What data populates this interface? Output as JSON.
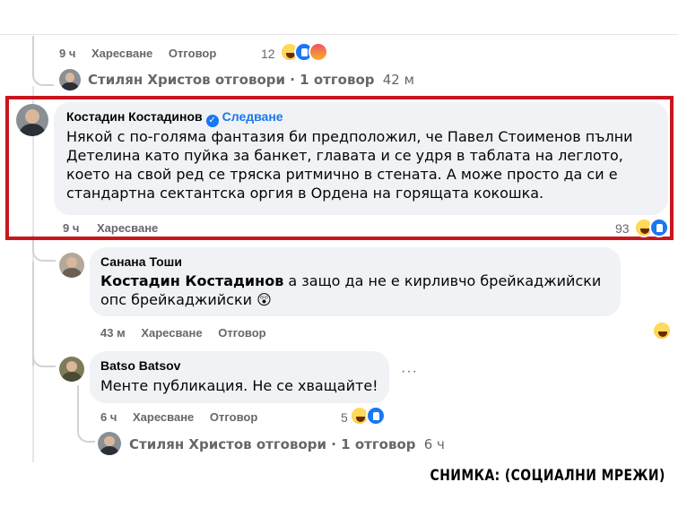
{
  "top_comment": {
    "time": "9 ч",
    "like_label": "Харесване",
    "reply_label": "Отговор",
    "reaction_count": "12"
  },
  "replies_row_1": {
    "text": "Стилян Христов отговори · 1 отговор",
    "time": "42 м"
  },
  "main_comment": {
    "author": "Костадин Костадинов",
    "verified_symbol": "✓",
    "follow_label": "Следване",
    "body": "Някой с по-голяма фантазия би предположил, че Павел Стоименов пълни Детелина като пуйка за банкет, главата и се удря в таблата на леглото, което на свой ред се тряска ритмично в стената. А може просто да си е стандартна сектантска оргия в Ордена на горящата кокошка.",
    "time": "9 ч",
    "like_label": "Харесване",
    "reaction_count": "93"
  },
  "reply_1": {
    "author": "Санана Тоши",
    "mention": "Костадин Костадинов",
    "body": "а защо да не е кирливчо брейкаджийски опс брейкаджийски",
    "emoji": "😲",
    "time": "43 м",
    "like_label": "Харесване",
    "reply_label": "Отговор"
  },
  "reply_2": {
    "author": "Batso Batsov",
    "body": "Менте публикация. Не се хващайте!",
    "time": "6 ч",
    "like_label": "Харесване",
    "reply_label": "Отговор",
    "reaction_count": "5",
    "more_symbol": "···"
  },
  "replies_row_2": {
    "text": "Стилян Христов отговори · 1 отговор",
    "time": "6 ч"
  },
  "caption": "СНИМКА: (СОЦИАЛНИ МРЕЖИ)",
  "colors": {
    "highlight_border": "#c8161d",
    "link_blue": "#1877f2",
    "bubble_bg": "#f0f2f5",
    "meta_gray": "#65676b"
  }
}
